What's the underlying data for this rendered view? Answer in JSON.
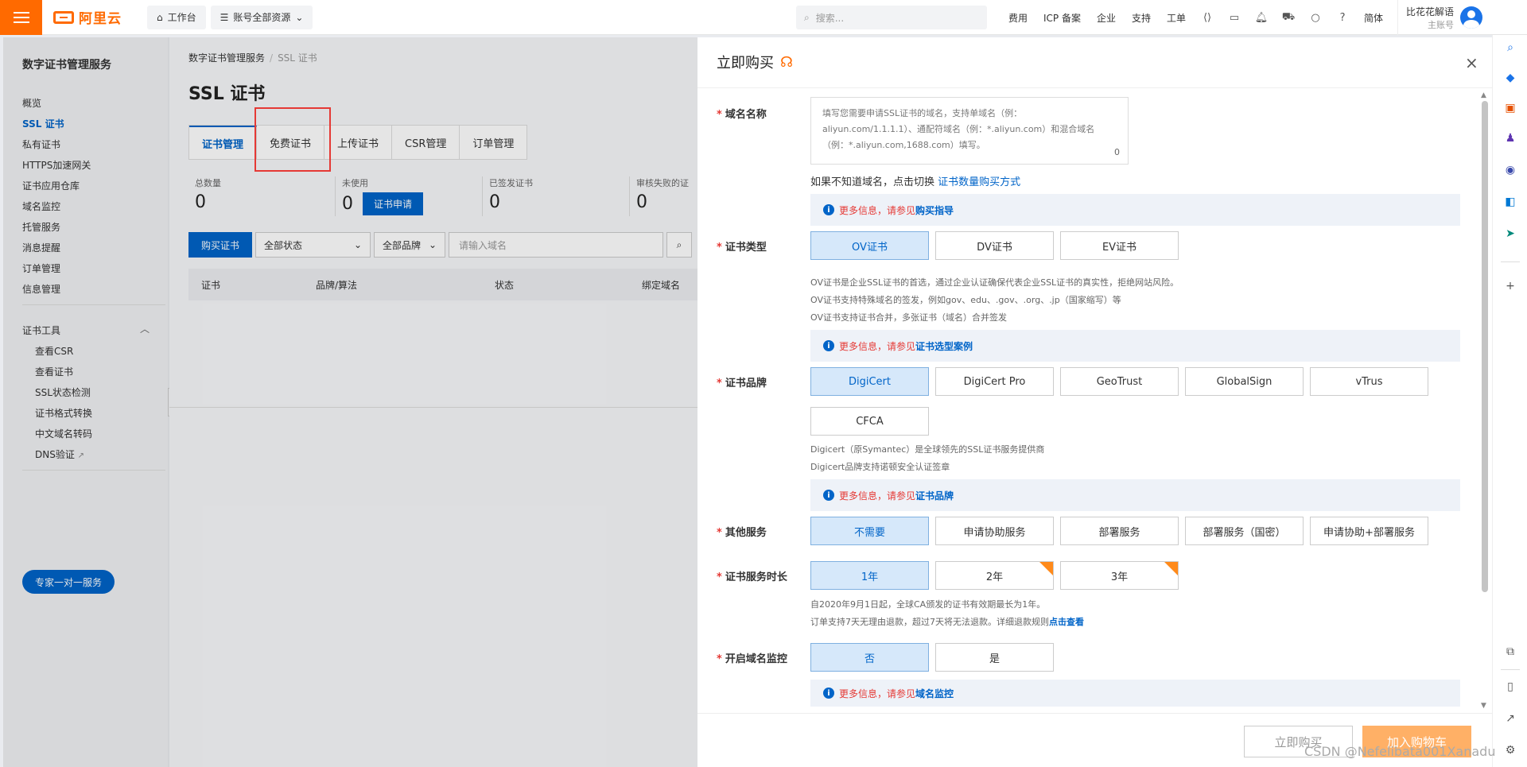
{
  "topbar": {
    "logo": "阿里云",
    "workbench": "工作台",
    "resources": "账号全部资源",
    "search_placeholder": "搜索...",
    "nav": [
      "费用",
      "ICP 备案",
      "企业",
      "支持",
      "工单"
    ],
    "lang": "简体",
    "user_name": "比花花解语",
    "user_role": "主账号"
  },
  "sidebar": {
    "title": "数字证书管理服务",
    "items": [
      "概览",
      "SSL 证书",
      "私有证书",
      "HTTPS加速网关",
      "证书应用仓库",
      "域名监控",
      "托管服务",
      "消息提醒",
      "订单管理",
      "信息管理"
    ],
    "tools_title": "证书工具",
    "tools": [
      "查看CSR",
      "查看证书",
      "SSL状态检测",
      "证书格式转换",
      "中文域名转码",
      "DNS验证"
    ],
    "expert_button": "专家一对一服务"
  },
  "main": {
    "breadcrumb": [
      "数字证书管理服务",
      "SSL 证书"
    ],
    "title": "SSL 证书",
    "tabs": [
      "证书管理",
      "免费证书",
      "上传证书",
      "CSR管理",
      "订单管理"
    ],
    "stats": [
      {
        "label": "总数量",
        "value": "0"
      },
      {
        "label": "未使用",
        "value": "0"
      },
      {
        "label": "已签发证书",
        "value": "0"
      },
      {
        "label": "审核失败的证",
        "value": "0"
      }
    ],
    "apply_button": "证书申请",
    "buy_button": "购买证书",
    "status_filter": "全部状态",
    "brand_filter": "全部品牌",
    "domain_placeholder": "请输入域名",
    "columns": [
      "证书",
      "品牌/算法",
      "状态",
      "绑定域名"
    ]
  },
  "drawer": {
    "title": "立即购买",
    "domain": {
      "label": "域名名称",
      "placeholder": "填写您需要申请SSL证书的域名，支持单域名（例：aliyun.com/1.1.1.1）、通配符域名（例：*.aliyun.com）和混合域名（例：*.aliyun.com,1688.com）填写。",
      "count": "0",
      "hint_prefix": "如果不知道域名，点击切换",
      "hint_link": "证书数量购买方式",
      "info_red": "更多信息，请参见",
      "info_link": "购买指导"
    },
    "cert_type": {
      "label": "证书类型",
      "options": [
        "OV证书",
        "DV证书",
        "EV证书"
      ],
      "desc": [
        "OV证书是企业SSL证书的首选，通过企业认证确保代表企业SSL证书的真实性，拒绝网站风险。",
        "OV证书支持特殊域名的签发，例如gov、edu、.gov、.org、.jp（国家缩写）等",
        "OV证书支持证书合并，多张证书（域名）合并签发"
      ],
      "info_red": "更多信息，请参见",
      "info_link": "证书选型案例"
    },
    "brand": {
      "label": "证书品牌",
      "options": [
        "DigiCert",
        "DigiCert Pro",
        "GeoTrust",
        "GlobalSign",
        "vTrus",
        "CFCA"
      ],
      "desc": [
        "Digicert（原Symantec）是全球领先的SSL证书服务提供商",
        "Digicert品牌支持诺顿安全认证签章"
      ],
      "info_red": "更多信息，请参见",
      "info_link": "证书品牌"
    },
    "other": {
      "label": "其他服务",
      "options": [
        "不需要",
        "申请协助服务",
        "部署服务",
        "部署服务（国密）",
        "申请协助+部署服务"
      ]
    },
    "duration": {
      "label": "证书服务时长",
      "options": [
        "1年",
        "2年",
        "3年"
      ],
      "desc1": "自2020年9月1日起，全球CA颁发的证书有效期最长为1年。",
      "desc2": "订单支持7天无理由退款，超过7天将无法退款。详细退款规则",
      "desc_link": "点击查看"
    },
    "monitor": {
      "label": "开启域名监控",
      "options": [
        "否",
        "是"
      ],
      "info_red": "更多信息，请参见",
      "info_link": "域名监控"
    },
    "buy_now": "立即购买",
    "add_cart": "加入购物车"
  },
  "watermark": "CSDN @Nefelibata001Xanadu",
  "colors": {
    "accent": "#0064c8",
    "brand": "#ff6a00",
    "required": "#e53935"
  }
}
